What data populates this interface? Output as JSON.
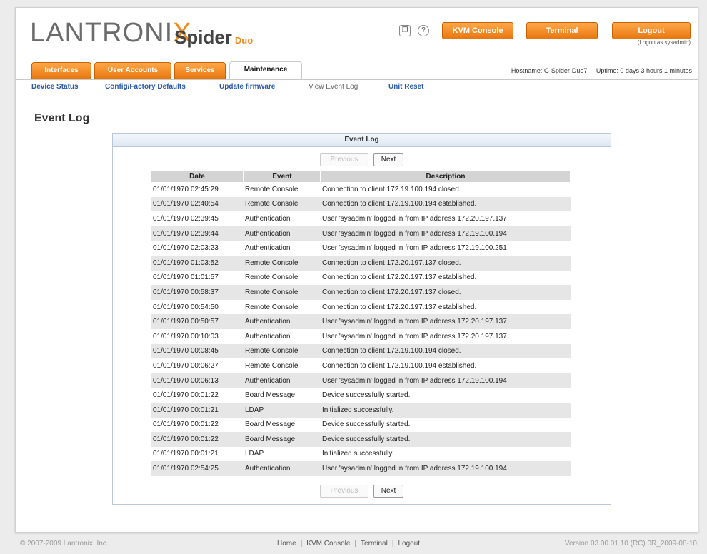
{
  "header": {
    "logo": "LANTRONIX",
    "product": "Spider",
    "product_suffix": "Duo",
    "kvm_console": "KVM Console",
    "terminal": "Terminal",
    "logout": "Logout",
    "logged_as": "(Logon as sysadmin)"
  },
  "tabs": [
    "Interfaces",
    "User Accounts",
    "Services",
    "Maintenance"
  ],
  "status": {
    "hostname": "Hostname: G-Spider-Duo7",
    "uptime": "Uptime: 0 days 3 hours 1 minutes"
  },
  "subnav": [
    "Device Status",
    "Config/Factory Defaults",
    "Update firmware",
    "View Event Log",
    "Unit Reset"
  ],
  "page_title": "Event Log",
  "panel": {
    "title": "Event Log",
    "previous": "Previous",
    "next": "Next",
    "columns": [
      "Date",
      "Event",
      "Description"
    ],
    "rows": [
      [
        "01/01/1970 02:45:29",
        "Remote Console",
        "Connection to client 172.19.100.194 closed."
      ],
      [
        "01/01/1970 02:40:54",
        "Remote Console",
        "Connection to client 172.19.100.194 established."
      ],
      [
        "01/01/1970 02:39:45",
        "Authentication",
        "User 'sysadmin' logged in from IP address 172.20.197.137"
      ],
      [
        "01/01/1970 02:39:44",
        "Authentication",
        "User 'sysadmin' logged in from IP address 172.19.100.194"
      ],
      [
        "01/01/1970 02:03:23",
        "Authentication",
        "User 'sysadmin' logged in from IP address 172.19.100.251"
      ],
      [
        "01/01/1970 01:03:52",
        "Remote Console",
        "Connection to client 172.20.197.137 closed."
      ],
      [
        "01/01/1970 01:01:57",
        "Remote Console",
        "Connection to client 172.20.197.137 established."
      ],
      [
        "01/01/1970 00:58:37",
        "Remote Console",
        "Connection to client 172.20.197.137 closed."
      ],
      [
        "01/01/1970 00:54:50",
        "Remote Console",
        "Connection to client 172.20.197.137 established."
      ],
      [
        "01/01/1970 00:50:57",
        "Authentication",
        "User 'sysadmin' logged in from IP address 172.20.197.137"
      ],
      [
        "01/01/1970 00:10:03",
        "Authentication",
        "User 'sysadmin' logged in from IP address 172.20.197.137"
      ],
      [
        "01/01/1970 00:08:45",
        "Remote Console",
        "Connection to client 172.19.100.194 closed."
      ],
      [
        "01/01/1970 00:06:27",
        "Remote Console",
        "Connection to client 172.19.100.194 established."
      ],
      [
        "01/01/1970 00:06:13",
        "Authentication",
        "User 'sysadmin' logged in from IP address 172.19.100.194"
      ],
      [
        "01/01/1970 00:01:22",
        "Board Message",
        "Device successfully started."
      ],
      [
        "01/01/1970 00:01:21",
        "LDAP",
        "Initialized successfully."
      ],
      [
        "01/01/1970 00:01:22",
        "Board Message",
        "Device successfully started."
      ],
      [
        "01/01/1970 00:01:22",
        "Board Message",
        "Device successfully started."
      ],
      [
        "01/01/1970 00:01:21",
        "LDAP",
        "Initialized successfully."
      ],
      [
        "01/01/1970 02:54:25",
        "Authentication",
        "User 'sysadmin' logged in from IP address 172.19.100.194"
      ]
    ]
  },
  "footer": {
    "copyright": "© 2007-2009 Lantronix, Inc.",
    "links": [
      "Home",
      "KVM Console",
      "Terminal",
      "Logout"
    ],
    "version": "Version 03.00.01.10 (RC) 0R_2009-08-10"
  },
  "colors": {
    "accent": "#f08a1c",
    "link": "#2a5aa8",
    "panel_border": "#b8c6d6"
  }
}
